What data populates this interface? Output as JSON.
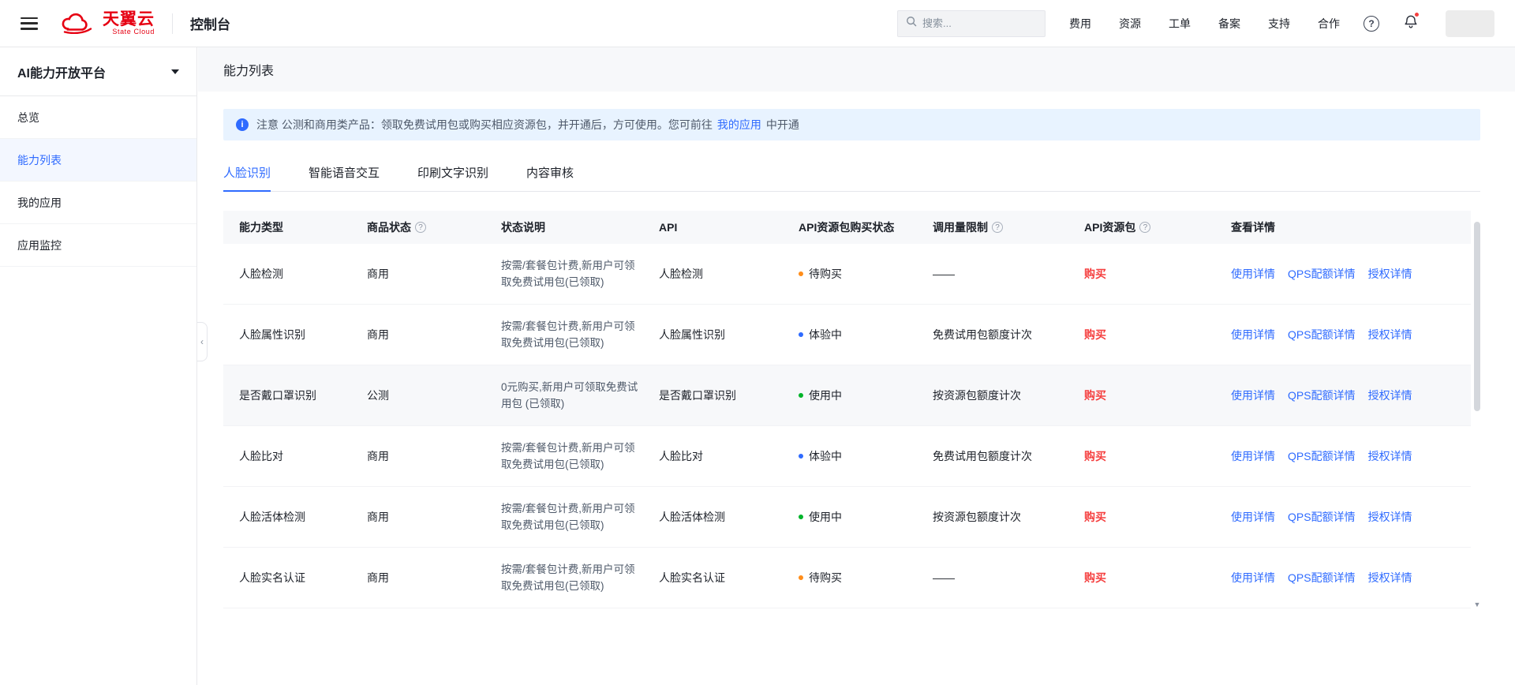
{
  "topbar": {
    "brand_name": "天翼云",
    "brand_sub": "State Cloud",
    "console_label": "控制台",
    "search_placeholder": "搜索...",
    "nav": [
      "费用",
      "资源",
      "工单",
      "备案",
      "支持",
      "合作"
    ],
    "help_glyph": "?"
  },
  "sidebar": {
    "title": "AI能力开放平台",
    "items": [
      {
        "label": "总览"
      },
      {
        "label": "能力列表"
      },
      {
        "label": "我的应用"
      },
      {
        "label": "应用监控"
      }
    ],
    "collapse_glyph": "‹"
  },
  "page": {
    "title": "能力列表",
    "notice_icon_glyph": "i",
    "notice_prefix": "注意 公测和商用类产品：领取免费试用包或购买相应资源包，并开通后，方可使用。您可前往",
    "notice_link": "我的应用",
    "notice_suffix": "中开通",
    "tabs": [
      "人脸识别",
      "智能语音交互",
      "印刷文字识别",
      "内容审核"
    ]
  },
  "table": {
    "columns": [
      "能力类型",
      "商品状态",
      "状态说明",
      "API",
      "API资源包购买状态",
      "调用量限制",
      "API资源包",
      "查看详情"
    ],
    "help_glyph": "?",
    "buy_label": "购买",
    "link_labels": [
      "使用详情",
      "QPS配额详情",
      "授权详情"
    ],
    "rows": [
      {
        "type": "人脸检测",
        "status": "商用",
        "desc": "按需/套餐包计费,新用户可领取免费试用包(已领取)",
        "api": "人脸检测",
        "state": "待购买",
        "state_color": "#ff8d1a",
        "limit": "——"
      },
      {
        "type": "人脸属性识别",
        "status": "商用",
        "desc": "按需/套餐包计费,新用户可领取免费试用包(已领取)",
        "api": "人脸属性识别",
        "state": "体验中",
        "state_color": "#2f6bff",
        "limit": "免费试用包额度计次"
      },
      {
        "type": "是否戴口罩识别",
        "status": "公测",
        "desc": "0元购买,新用户可领取免费试用包 (已领取)",
        "api": "是否戴口罩识别",
        "state": "使用中",
        "state_color": "#00b42a",
        "limit": "按资源包额度计次"
      },
      {
        "type": "人脸比对",
        "status": "商用",
        "desc": "按需/套餐包计费,新用户可领取免费试用包(已领取)",
        "api": "人脸比对",
        "state": "体验中",
        "state_color": "#2f6bff",
        "limit": "免费试用包额度计次"
      },
      {
        "type": "人脸活体检测",
        "status": "商用",
        "desc": "按需/套餐包计费,新用户可领取免费试用包(已领取)",
        "api": "人脸活体检测",
        "state": "使用中",
        "state_color": "#00b42a",
        "limit": "按资源包额度计次"
      },
      {
        "type": "人脸实名认证",
        "status": "商用",
        "desc": "按需/套餐包计费,新用户可领取免费试用包(已领取)",
        "api": "人脸实名认证",
        "state": "待购买",
        "state_color": "#ff8d1a",
        "limit": "——"
      }
    ]
  },
  "colors": {
    "accent_blue": "#2f6bff",
    "brand_red": "#e60012",
    "buy_red": "#f53f3f",
    "dot_orange": "#ff8d1a",
    "dot_blue": "#2f6bff",
    "dot_green": "#00b42a",
    "notice_bg": "#e8f3ff"
  }
}
